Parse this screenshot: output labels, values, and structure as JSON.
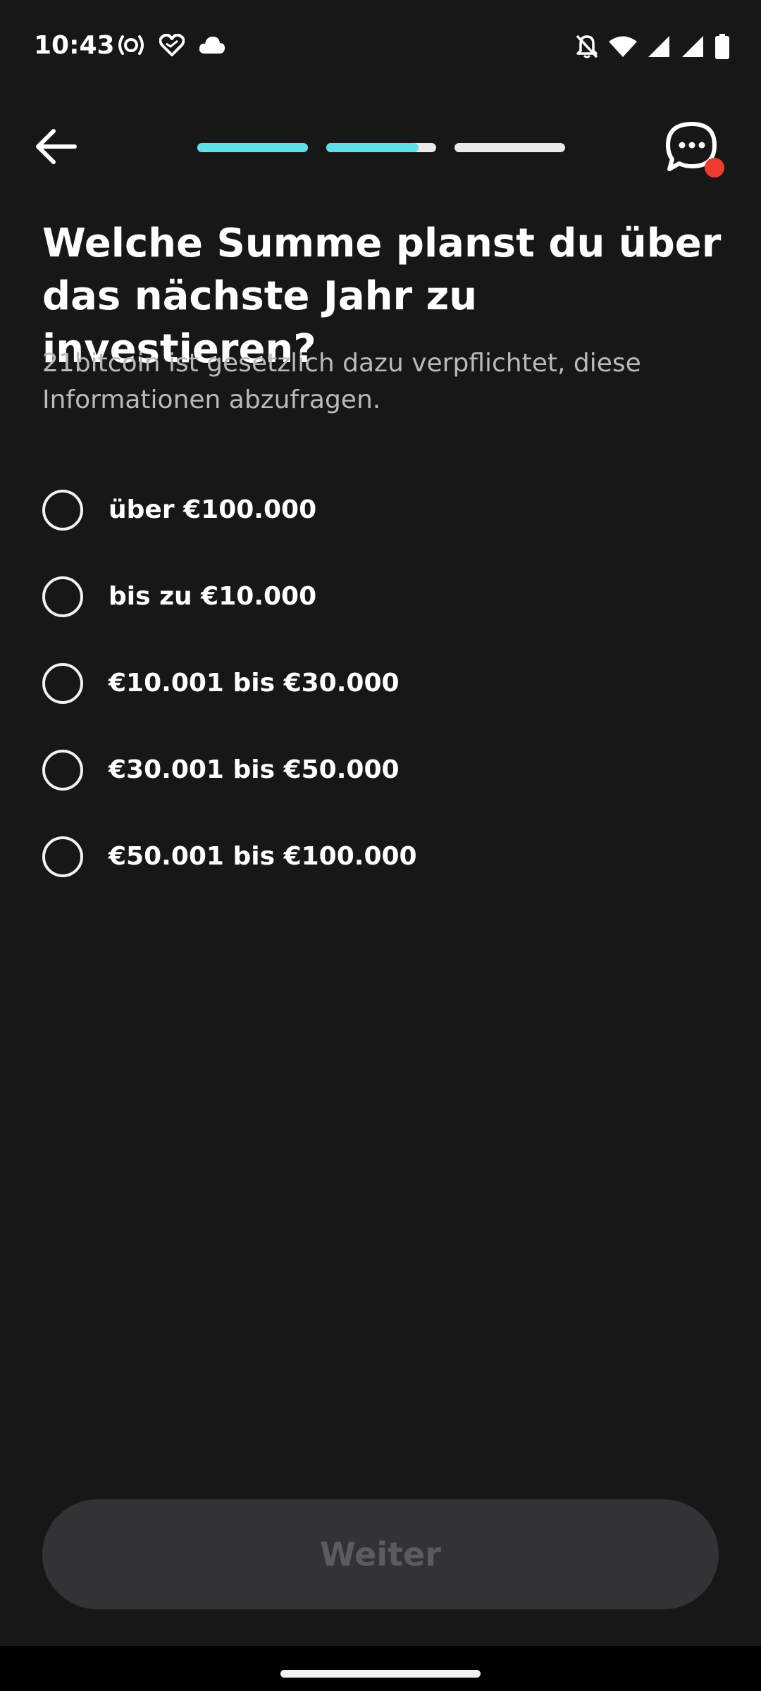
{
  "status_bar": {
    "time": "10:43",
    "left_icons": [
      "hotspot-icon",
      "heart-icon",
      "cloud-icon"
    ],
    "right_icons": [
      "bell-off-icon",
      "wifi-icon",
      "signal-icon",
      "signal-icon",
      "battery-icon"
    ]
  },
  "header": {
    "back_icon": "arrow-left-icon",
    "chat_icon": "chat-bubble-icon",
    "chat_badge_color": "#ee3b2f",
    "progress": [
      {
        "fill": 1.0
      },
      {
        "fill": 0.84
      },
      {
        "fill": 0.0
      }
    ],
    "progress_color": "#5ee0ea"
  },
  "question": {
    "title": "Welche Summe planst du über das nächste Jahr zu investieren?",
    "subtitle": "21bitcoin ist gesetzlich dazu verpflichtet, diese Informationen abzufragen."
  },
  "options": [
    {
      "label": "über €100.000",
      "selected": false
    },
    {
      "label": "bis zu €10.000",
      "selected": false
    },
    {
      "label": "€10.001 bis €30.000",
      "selected": false
    },
    {
      "label": "€30.001 bis €50.000",
      "selected": false
    },
    {
      "label": "€50.001 bis €100.000",
      "selected": false
    }
  ],
  "footer": {
    "next_label": "Weiter",
    "next_enabled": false
  }
}
